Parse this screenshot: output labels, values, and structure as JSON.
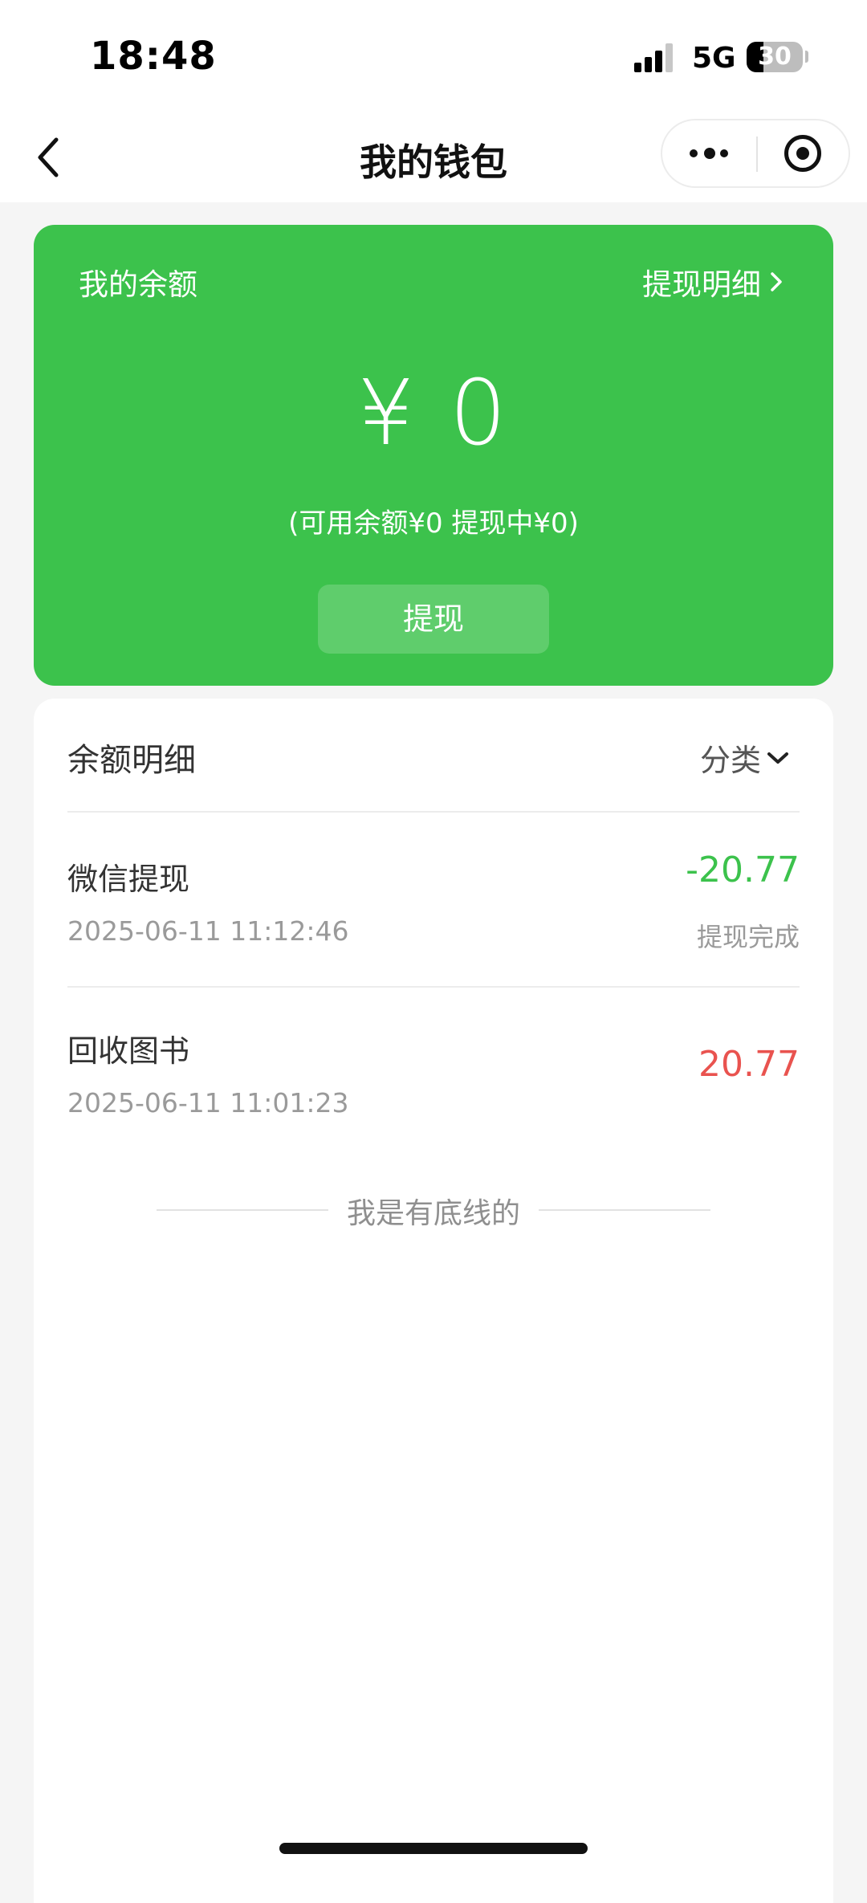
{
  "status_bar": {
    "time": "18:48",
    "network": "5G",
    "battery": "30",
    "battery_level": 0.3
  },
  "nav": {
    "title": "我的钱包",
    "back_icon": "chevron-left-icon",
    "more_icon": "more-dots-icon",
    "close_icon": "target-circle-icon"
  },
  "balance_card": {
    "label": "我的余额",
    "withdraw_detail_link": "提现明细",
    "amount": "¥ 0",
    "sub_info": "(可用余额¥0 提现中¥0)",
    "withdraw_button": "提现",
    "card_color": "#3cc24c"
  },
  "details": {
    "title": "余额明细",
    "filter_label": "分类",
    "transactions": [
      {
        "title": "微信提现",
        "time": "2025-06-11 11:12:46",
        "amount": "-20.77",
        "status": "提现完成",
        "amount_color": "#3cc24c"
      },
      {
        "title": "回收图书",
        "time": "2025-06-11 11:01:23",
        "amount": "20.77",
        "status": "",
        "amount_color": "#e9534f"
      }
    ],
    "end_text": "我是有底线的"
  }
}
